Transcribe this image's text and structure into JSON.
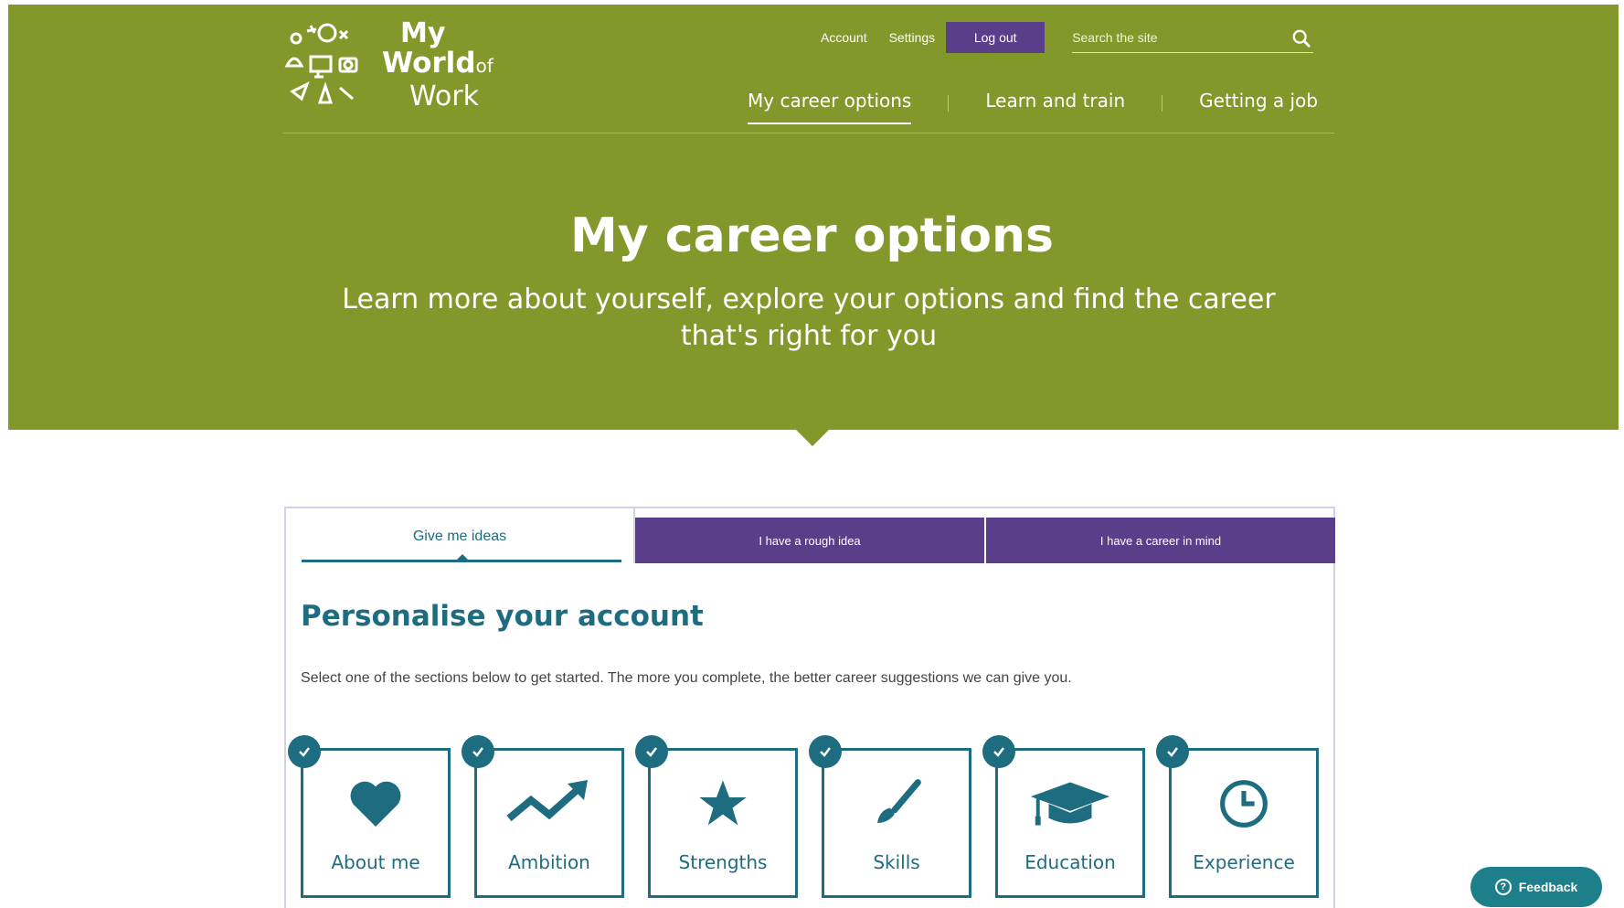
{
  "header": {
    "logo": {
      "line1": "My",
      "line2": "World",
      "line2_suffix": "of",
      "line3": "Work"
    },
    "utility": {
      "account": "Account",
      "settings": "Settings",
      "logout": "Log out"
    },
    "search": {
      "placeholder": "Search the site"
    },
    "nav": [
      "My career options",
      "Learn and train",
      "Getting a job"
    ]
  },
  "hero": {
    "title": "My career options",
    "subtitle": "Learn more about yourself, explore your options and find the career that's right for you"
  },
  "tabs": [
    "Give me ideas",
    "I have a rough idea",
    "I have a career in mind"
  ],
  "panel": {
    "title": "Personalise your account",
    "description": "Select one of the sections below to get started. The more you complete, the better career suggestions we can give you."
  },
  "cards": [
    {
      "label": "About me",
      "icon": "heart-icon",
      "completed": true
    },
    {
      "label": "Ambition",
      "icon": "trending-up-icon",
      "completed": true
    },
    {
      "label": "Strengths",
      "icon": "star-icon",
      "completed": true
    },
    {
      "label": "Skills",
      "icon": "paintbrush-icon",
      "completed": true
    },
    {
      "label": "Education",
      "icon": "graduation-cap-icon",
      "completed": true
    },
    {
      "label": "Experience",
      "icon": "clock-icon",
      "completed": true
    }
  ],
  "feedback": {
    "label": "Feedback"
  },
  "colors": {
    "hero": "#83982a",
    "purple": "#5a3e8a",
    "teal": "#1d6c80"
  }
}
